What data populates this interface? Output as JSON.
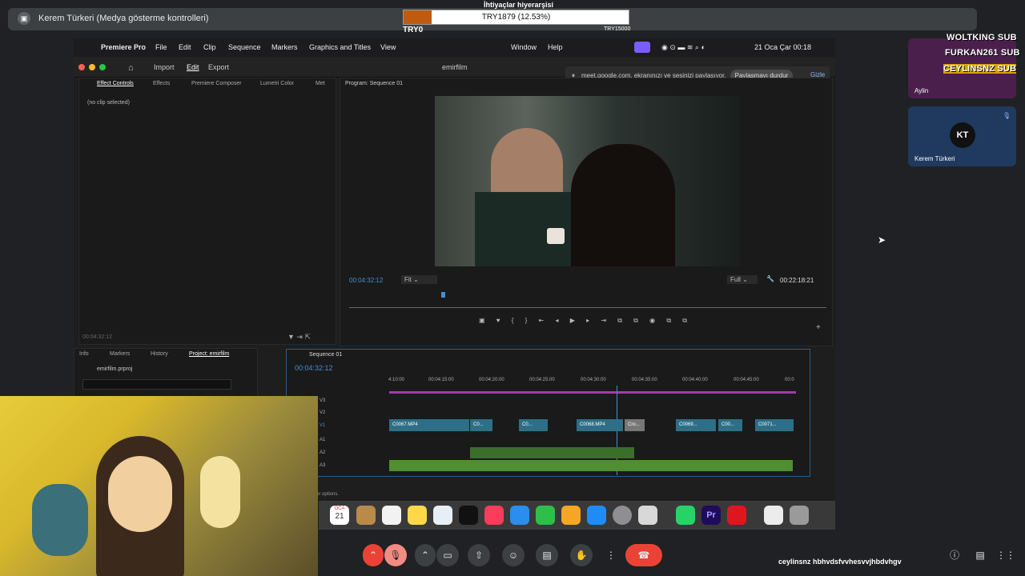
{
  "meet": {
    "presenter_label": "Kerem Türkeri (Medya gösterme kontrolleri)",
    "share_notice": "meet.google.com, ekranınızı ve sesinizi paylaşıyor.",
    "stop_share": "Paylaşmayı durdur",
    "hide": "Gizle"
  },
  "donation": {
    "label": "İhtiyaçlar hiyerarşisi",
    "value_text": "TRY1879 (12.53%)",
    "progress_percent": 12.53,
    "min": "TRY0",
    "max": "TRY15000",
    "fill_color": "#c05a0e"
  },
  "macos_menu": {
    "app": "Premiere Pro",
    "items": [
      "File",
      "Edit",
      "Clip",
      "Sequence",
      "Markers",
      "Graphics and Titles",
      "View",
      "Window",
      "Help"
    ],
    "datetime": "21 Oca Çar  00:18"
  },
  "premiere": {
    "workspaces": [
      "Import",
      "Edit",
      "Export"
    ],
    "active_workspace": "Edit",
    "project_title": "emirfilm",
    "source_tabs": [
      "Effect Controls",
      "Effects",
      "Premiere Composer",
      "Lumetri Color",
      "Met"
    ],
    "no_clip": "(no clip selected)",
    "source_time": "00:04:32:12",
    "program_tab": "Program: Sequence 01",
    "program_time": "00:04:32:12",
    "fit_option": "Fit",
    "full_option": "Full",
    "duration": "00:22:18:21",
    "project_tabs": [
      "Info",
      "Markers",
      "History",
      "Project: emirfilm"
    ],
    "project_file": "emirfilm.prproj",
    "sequence_tab": "Sequence 01",
    "timeline_time": "00:04:32:12",
    "ruler": [
      "4:10:00",
      "00:04:15:00",
      "00:04:20:00",
      "00:04:25:00",
      "00:04:30:00",
      "00:04:35:00",
      "00:04:40:00",
      "00:04:45:00",
      "00:0"
    ],
    "video_tracks": [
      "V3",
      "V2",
      "V1"
    ],
    "audio_tracks": [
      "A1",
      "A2",
      "A3"
    ],
    "clips": [
      "C0067.MP4",
      "C0...",
      "C0...",
      "C0068.MP4",
      "Cro...",
      "C0069...",
      "C00...",
      "C0071..."
    ],
    "status": "er options."
  },
  "participants": [
    {
      "name": "Aylin"
    },
    {
      "name": "Kerem Türkeri",
      "avatar_text": "KT"
    }
  ],
  "subs": [
    "WOLTKING SUB",
    "FURKAN261 SUB",
    "CEYLINSNZ SUB"
  ],
  "chat": {
    "user": "ceylinsnz",
    "message": "hbhvdsfvvhesvvjhbdvhgv"
  },
  "dock_date": {
    "month": "OCA",
    "day": "21"
  }
}
